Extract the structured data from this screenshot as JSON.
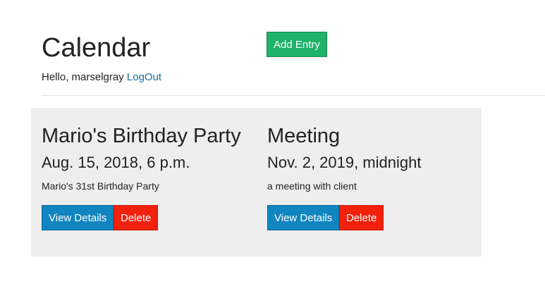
{
  "header": {
    "title": "Calendar",
    "greeting_prefix": "Hello, marselgray",
    "logout_label": "LogOut",
    "add_entry_label": "Add Entry"
  },
  "entries": [
    {
      "title": "Mario's Birthday Party",
      "date": "Aug. 15, 2018, 6 p.m.",
      "description": "Mario's 31st Birthday Party",
      "view_label": "View Details",
      "delete_label": "Delete"
    },
    {
      "title": "Meeting",
      "date": "Nov. 2, 2019, midnight",
      "description": "a meeting with client",
      "view_label": "View Details",
      "delete_label": "Delete"
    }
  ],
  "colors": {
    "add_button": "#1fb36a",
    "view_button": "#1185c0",
    "delete_button": "#f2210c",
    "link": "#1a6f9a",
    "panel_background": "#eeeeee"
  }
}
